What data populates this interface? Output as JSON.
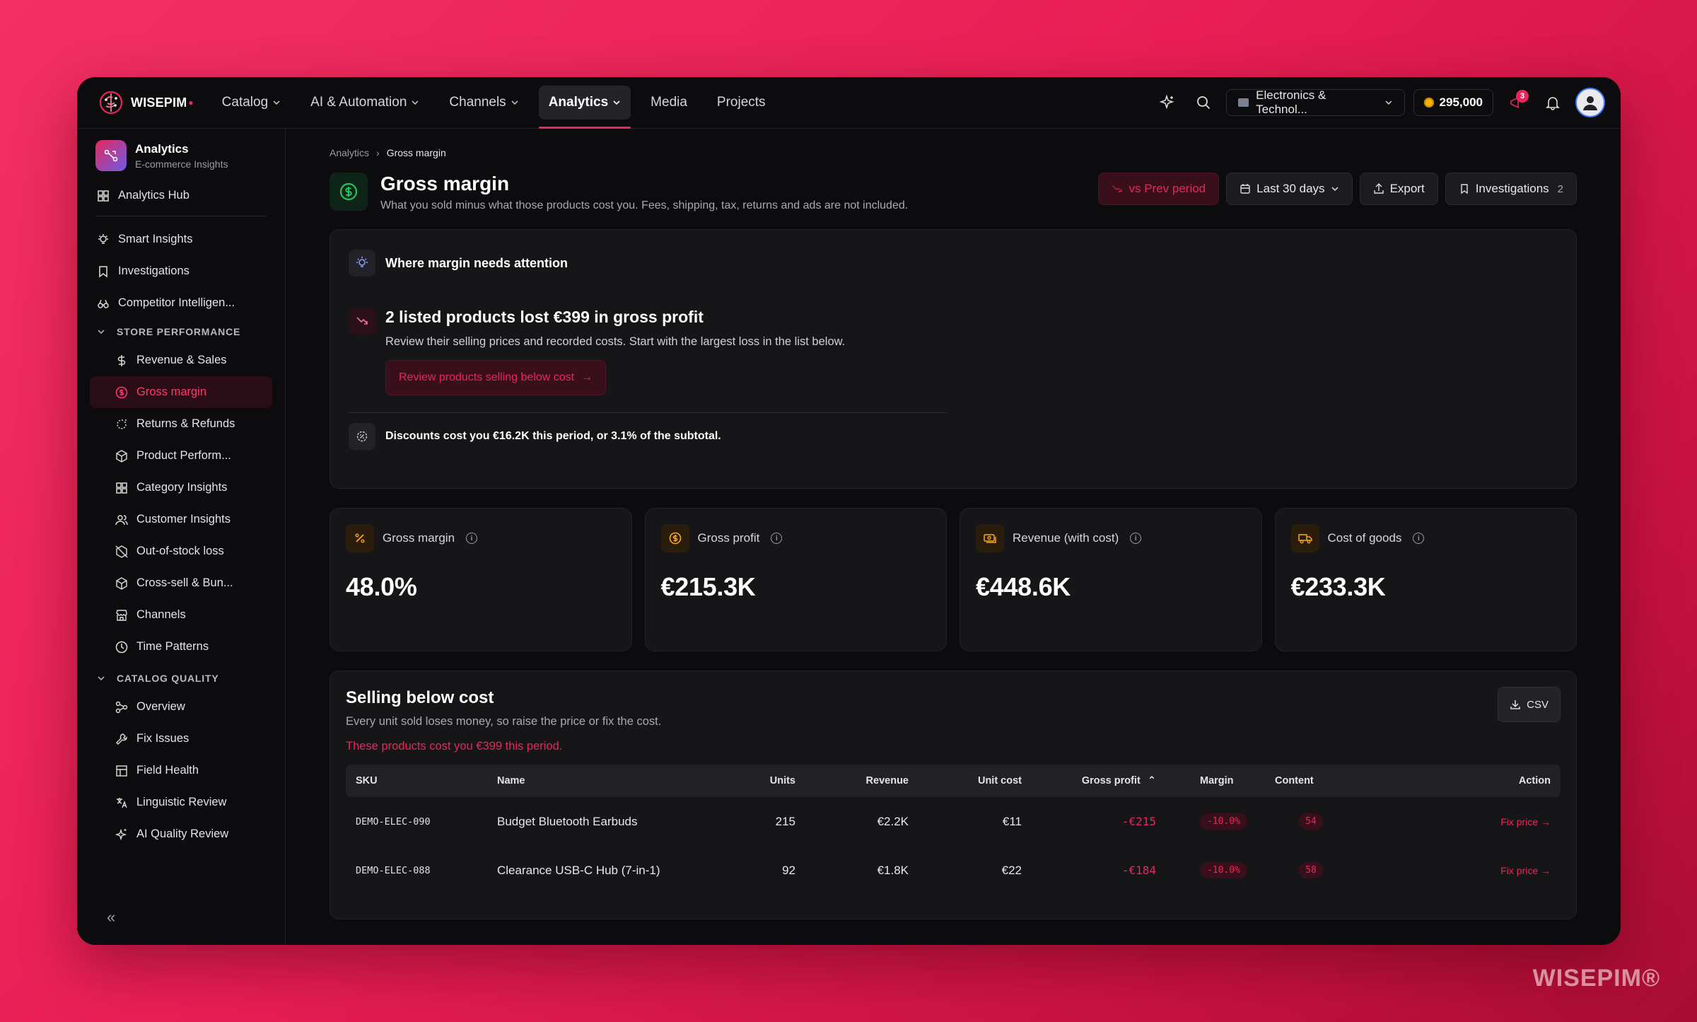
{
  "brand": {
    "logo_text": "WISEPIM",
    "watermark": "WISEPIM®"
  },
  "nav": {
    "items": [
      {
        "label": "Catalog",
        "dropdown": true
      },
      {
        "label": "AI & Automation",
        "dropdown": true
      },
      {
        "label": "Channels",
        "dropdown": true
      },
      {
        "label": "Analytics",
        "dropdown": true,
        "active": true
      },
      {
        "label": "Media",
        "dropdown": false
      },
      {
        "label": "Projects",
        "dropdown": false
      }
    ],
    "store": "Electronics & Technol...",
    "credits": "295,000",
    "notifications_count": "3"
  },
  "sidebar": {
    "title": "Analytics",
    "subtitle": "E-commerce Insights",
    "hub": "Analytics Hub",
    "top_items": [
      "Smart Insights",
      "Investigations",
      "Competitor Intelligen..."
    ],
    "section_store": "STORE PERFORMANCE",
    "store_items": [
      "Revenue & Sales",
      "Gross margin",
      "Returns & Refunds",
      "Product Perform...",
      "Category Insights",
      "Customer Insights",
      "Out-of-stock loss",
      "Cross-sell & Bun...",
      "Channels",
      "Time Patterns"
    ],
    "section_catalog": "CATALOG QUALITY",
    "catalog_items": [
      "Overview",
      "Fix Issues",
      "Field Health",
      "Linguistic Review",
      "AI Quality Review"
    ],
    "collapse": "«"
  },
  "breadcrumb": {
    "root": "Analytics",
    "current": "Gross margin"
  },
  "page": {
    "title": "Gross margin",
    "description": "What you sold minus what those products cost you. Fees, shipping, tax, returns and ads are not included.",
    "compare_btn": "vs Prev period",
    "range_btn": "Last 30 days",
    "export_btn": "Export",
    "investigations_btn": "Investigations",
    "investigations_count": "2"
  },
  "attention": {
    "heading": "Where margin needs attention",
    "title": "2 listed products lost €399 in gross profit",
    "description": "Review their selling prices and recorded costs. Start with the largest loss in the list below.",
    "cta": "Review products selling below cost",
    "discount_note": "Discounts cost you €16.2K this period, or 3.1% of the subtotal."
  },
  "kpis": [
    {
      "label": "Gross margin",
      "value": "48.0%",
      "icon": "percent-icon"
    },
    {
      "label": "Gross profit",
      "value": "€215.3K",
      "icon": "dollar-coin-icon"
    },
    {
      "label": "Revenue (with cost)",
      "value": "€448.6K",
      "icon": "cash-icon"
    },
    {
      "label": "Cost of goods",
      "value": "€233.3K",
      "icon": "truck-icon"
    }
  ],
  "below_cost": {
    "title": "Selling below cost",
    "subtitle": "Every unit sold loses money, so raise the price or fix the cost.",
    "warning": "These products cost you €399 this period.",
    "csv_btn": "CSV",
    "columns": [
      "SKU",
      "Name",
      "Units",
      "Revenue",
      "Unit cost",
      "Gross profit",
      "Margin",
      "Content",
      "Action"
    ],
    "rows": [
      {
        "sku": "DEMO-ELEC-090",
        "name": "Budget Bluetooth Earbuds",
        "units": "215",
        "revenue": "€2.2K",
        "unit_cost": "€11",
        "gross_profit": "-€215",
        "margin": "-10.0%",
        "content": "54",
        "action": "Fix price →"
      },
      {
        "sku": "DEMO-ELEC-088",
        "name": "Clearance USB-C Hub (7-in-1)",
        "units": "92",
        "revenue": "€1.8K",
        "unit_cost": "€22",
        "gross_profit": "-€184",
        "margin": "-10.0%",
        "content": "58",
        "action": "Fix price →"
      }
    ]
  },
  "colors": {
    "accent": "#e8275c",
    "background": "#0c0c0e",
    "card": "#161618",
    "kpi_icon": "#f5a623",
    "positive": "#22c55e"
  }
}
